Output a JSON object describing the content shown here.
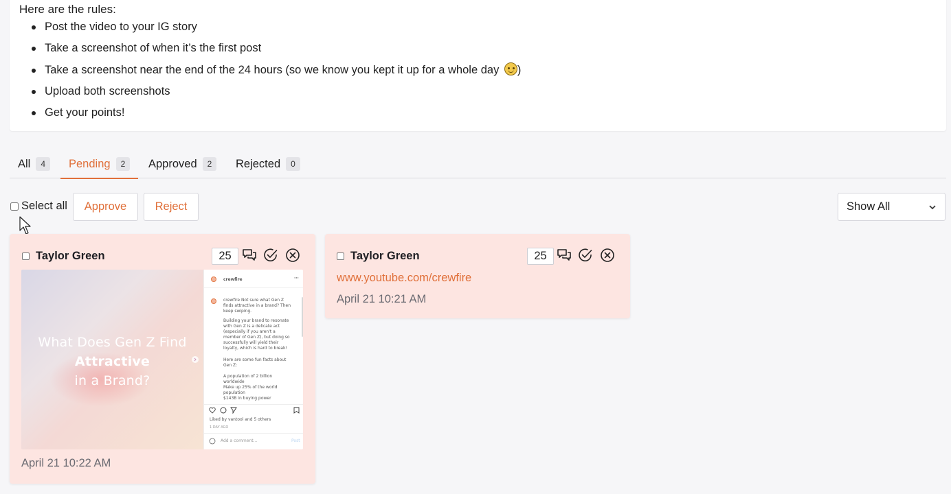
{
  "rules": {
    "heading": "Here are the rules:",
    "items": [
      "Post the video to your IG story",
      "Take a screenshot of when it’s the first post",
      "Take a screenshot near the end of the 24 hours (so we know you kept it up for a whole day",
      "Upload both screenshots",
      "Get your points!"
    ],
    "item3_suffix": ")"
  },
  "tabs": [
    {
      "label": "All",
      "count": "4"
    },
    {
      "label": "Pending",
      "count": "2"
    },
    {
      "label": "Approved",
      "count": "2"
    },
    {
      "label": "Rejected",
      "count": "0"
    }
  ],
  "active_tab": "Pending",
  "toolbar": {
    "select_all_label": "Select all",
    "approve_label": "Approve",
    "reject_label": "Reject",
    "filter_value": "Show All"
  },
  "submissions": [
    {
      "name": "Taylor Green",
      "points": "25",
      "date": "April 21 10:22 AM",
      "thumbnail": {
        "video_title_line1": "What Does Gen Z Find",
        "video_title_line2": "Attractive",
        "video_title_line3": "in a Brand?",
        "post_account": "crewfire",
        "post_caption": "crewfire Not sure what Gen Z finds attractive in a brand? Then keep swiping.",
        "post_body_1": "Building your brand to resonate with Gen Z is a delicate act (especially if you aren't a member of Gen Z), but doing so successfully will yield their loyalty, which is hard to break!",
        "post_body_2": "Here are some fun facts about Gen Z:",
        "post_bullet_1": "A population of 2 billion worldwide",
        "post_bullet_2": "Make up 25% of the world population",
        "post_bullet_3": "$143B in buying power",
        "liked_by": "Liked by vantool and 5 others",
        "post_age": "1 DAY AGO",
        "comment_placeholder": "Add a comment...",
        "post_action": "Post"
      }
    },
    {
      "name": "Taylor Green",
      "points": "25",
      "link": "www.youtube.com/crewfire",
      "date": "April 21 10:21 AM"
    }
  ],
  "colors": {
    "accent": "#e0703a",
    "card_bg": "#fde5e1",
    "page_bg": "#f6f6f8"
  },
  "icons": {
    "comment": "comment-bubbles-icon",
    "approve": "check-circle-icon",
    "reject": "x-circle-icon",
    "dropdown": "chevron-down-icon",
    "cursor": "mouse-cursor-icon"
  }
}
